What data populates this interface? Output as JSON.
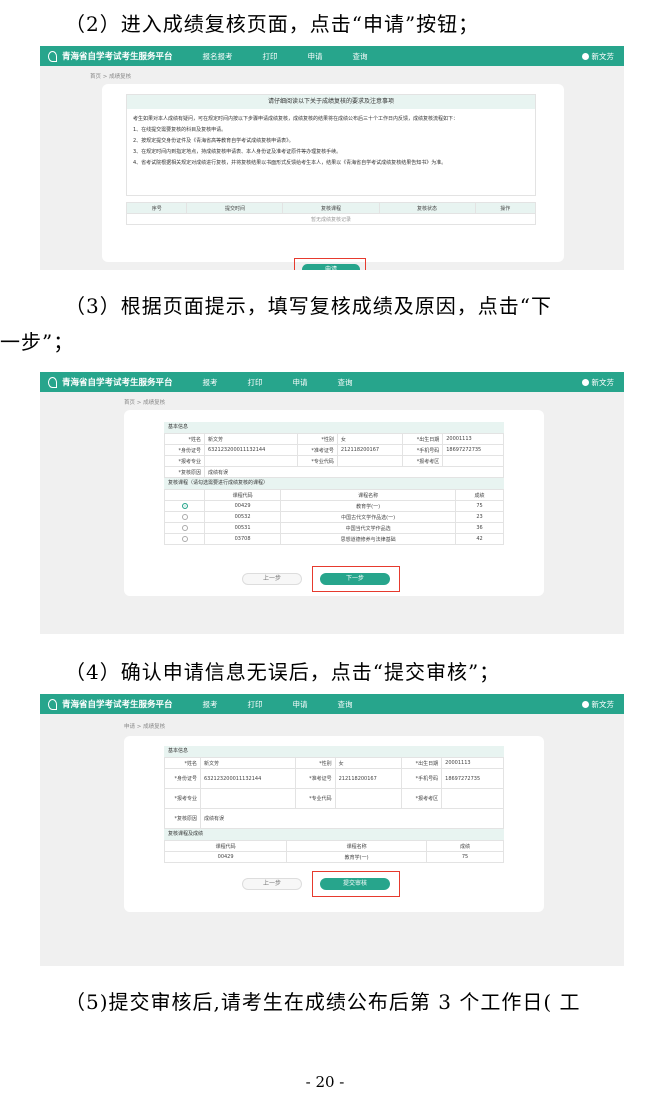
{
  "text": {
    "p2": "（2）进入成绩复核页面，点击“申请”按钮；",
    "p3_l1": "（3）根据页面提示，填写复核成绩及原因，点击“下",
    "p3_l2": "一步”；",
    "p4": "（4）确认申请信息无误后，点击“提交审核”；",
    "p5": "（5)提交审核后,请考生在成绩公布后第 3 个工作日( 工",
    "page_number": "- 20 -"
  },
  "app": {
    "title": "青海省自学考试考生服务平台",
    "nav": [
      "报名报考",
      "打印",
      "申请",
      "查询"
    ],
    "nav_short": [
      "报考",
      "打印",
      "申请",
      "查询"
    ],
    "user": "新文芳",
    "crumb_1": "首页 > 成绩复核",
    "crumb_2": "申请 > 成绩复核"
  },
  "shot1": {
    "notice_title": "请仔细阅读以下关于成绩复核的要求及注意事项",
    "notice_lines": [
      "考生如果对本人成绩有疑问，可在规定时间内按以下步骤申请成绩复核，成绩复核的结果将在成绩公布后三十个工作日内反馈，成绩复核流程如下：",
      "1、在线提交需要复核的科目及复核申请。",
      "2、按规定提交身份证件及《青海省高等教育自学考试成绩复核申请表》。",
      "3、在规定时间内到指定地点，持成绩复核申请表、本人身份证及准考证原件等办理复核手续。",
      "4、省考试院根据相关规定对成绩进行复核，并将复核结果以书面形式反馈给考生本人，结果以《青海省自学考试成绩复核结果告知书》为准。"
    ],
    "cols": [
      "序号",
      "提交时间",
      "复核课程",
      "复核状态",
      "操作"
    ],
    "empty": "暂无成绩复核记录",
    "apply_btn": "申请"
  },
  "shot2": {
    "section_basic": "基本信息",
    "section_courses": "复核课程（请勾选需要进行成绩复核的课程）",
    "name_label": "*姓名",
    "name": "新文芳",
    "gender_label": "*性别",
    "gender": "女",
    "birth_label": "*出生日期",
    "birth": "20001113",
    "id_label": "*身份证号",
    "id": "632123200011132144",
    "exam_no_label": "*准考证号",
    "exam_no": "212118200167",
    "phone_label": "*手机号码",
    "phone": "18697272735",
    "major_label": "*报考专业",
    "major_code_label": "*专业代码",
    "exam_area_label": "*报考考区",
    "reason_label": "*复核原因",
    "reason": "成绩有误",
    "course_cols": [
      "",
      "课程代码",
      "课程名称",
      "成绩"
    ],
    "courses": [
      {
        "code": "00429",
        "name": "教育学(一)",
        "score": "75"
      },
      {
        "code": "00532",
        "name": "中国古代文学作品选(一)",
        "score": "23"
      },
      {
        "code": "00531",
        "name": "中国当代文学作品选",
        "score": "36"
      },
      {
        "code": "03708",
        "name": "思想道德修养与法律基础",
        "score": "42"
      }
    ],
    "prev_btn": "上一步",
    "next_btn": "下一步"
  },
  "shot3": {
    "section_basic": "基本信息",
    "section_courses": "复核课程及成绩",
    "name_label": "*姓名",
    "id_label": "*身份证号",
    "major_label": "*报考专业",
    "reason_label": "*复核原因",
    "gender_label": "*性别",
    "exam_no_label": "*准考证号",
    "major_code_label": "*专业代码",
    "birth_label": "*出生日期",
    "phone_label": "*手机号码",
    "exam_area_label": "*报考考区",
    "course_cols": [
      "课程代码",
      "课程名称",
      "成绩"
    ],
    "course": {
      "code": "00429",
      "name": "教育学(一)",
      "score": "75"
    },
    "prev_btn": "上一步",
    "submit_btn": "提交审核"
  }
}
